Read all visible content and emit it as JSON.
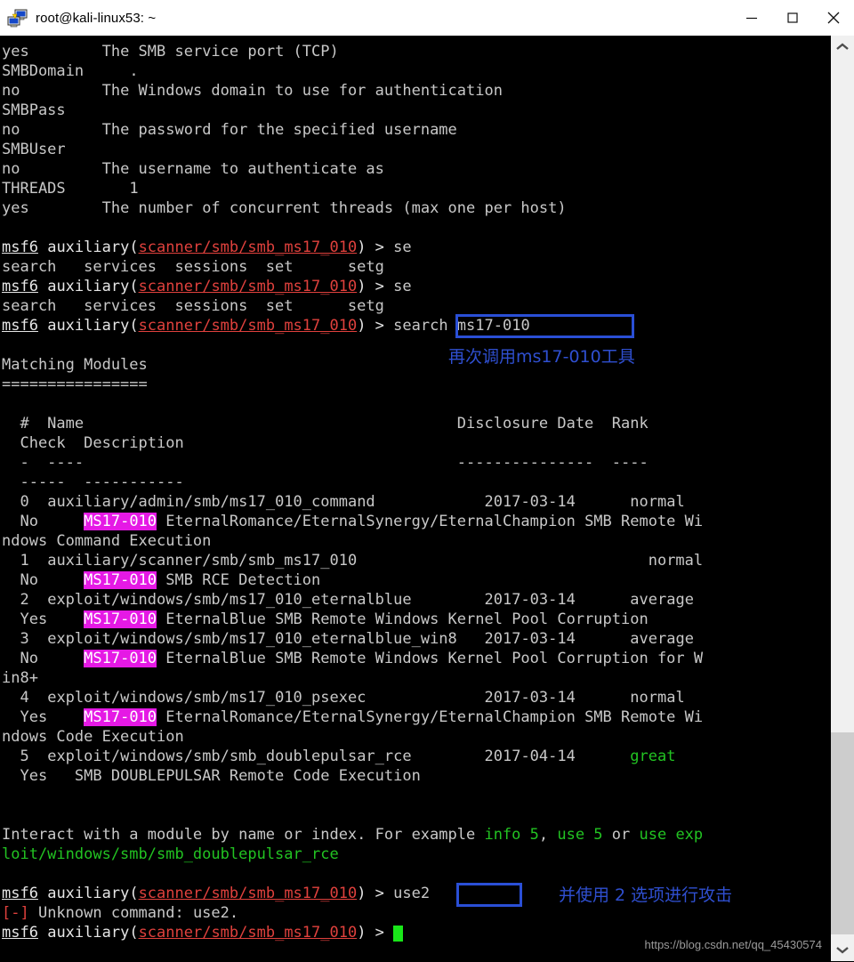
{
  "window": {
    "title": "root@kali-linux53: ~",
    "icon": "computer-network-icon",
    "minimize_label": "—",
    "maximize_label": "□",
    "close_label": "✕"
  },
  "terminal": {
    "prompt_user": "msf6",
    "prompt_cmd": "auxiliary(",
    "prompt_module": "scanner/smb/smb_ms17_010",
    "prompt_tail": ") > ",
    "options_rows": [
      {
        "value": "yes",
        "desc": "The SMB service port (TCP)"
      },
      {
        "value": "SMBDomain",
        "desc": "."
      },
      {
        "value": "no",
        "desc": "The Windows domain to use for authentication"
      },
      {
        "value": "SMBPass",
        "desc": ""
      },
      {
        "value": "no",
        "desc": "The password for the specified username"
      },
      {
        "value": "SMBUser",
        "desc": ""
      },
      {
        "value": "no",
        "desc": "The username to authenticate as"
      },
      {
        "value": "THREADS",
        "desc": "1"
      },
      {
        "value": "yes",
        "desc": "The number of concurrent threads (max one per host)"
      }
    ],
    "completion_line": "search   services  sessions  set      setg",
    "partial_command": "se",
    "search_command": "search ms17-010",
    "matching_header": "Matching Modules",
    "matching_underline": "================",
    "col_head_1": "  #  Name",
    "col_head_1_right": "Disclosure Date  Rank",
    "col_head_2": "  Check  Description",
    "col_rule_1": "  -  ----",
    "col_rule_1_right": "---------------  ----",
    "col_rule_2": "  -----  -----------",
    "modules": [
      {
        "index": "  0",
        "name": "auxiliary/admin/smb/ms17_010_command",
        "date": "2017-03-14",
        "rank": "normal",
        "rank_color": "grey",
        "check": "  No",
        "hl": "MS17-010",
        "desc": " EternalRomance/EternalSynergy/EternalChampion SMB Remote Wi",
        "desc_wrap": "ndows Command Execution"
      },
      {
        "index": "  1",
        "name": "auxiliary/scanner/smb/smb_ms17_010",
        "date": "",
        "rank": "normal",
        "rank_color": "grey",
        "check": "  No",
        "hl": "MS17-010",
        "desc": " SMB RCE Detection",
        "desc_wrap": ""
      },
      {
        "index": "  2",
        "name": "exploit/windows/smb/ms17_010_eternalblue",
        "date": "2017-03-14",
        "rank": "average",
        "rank_color": "grey",
        "check": "  Yes",
        "hl": "MS17-010",
        "desc": " EternalBlue SMB Remote Windows Kernel Pool Corruption",
        "desc_wrap": ""
      },
      {
        "index": "  3",
        "name": "exploit/windows/smb/ms17_010_eternalblue_win8",
        "date": "2017-03-14",
        "rank": "average",
        "rank_color": "grey",
        "check": "  No",
        "hl": "MS17-010",
        "desc": " EternalBlue SMB Remote Windows Kernel Pool Corruption for W",
        "desc_wrap": "in8+"
      },
      {
        "index": "  4",
        "name": "exploit/windows/smb/ms17_010_psexec",
        "date": "2017-03-14",
        "rank": "normal",
        "rank_color": "grey",
        "check": "  Yes",
        "hl": "MS17-010",
        "desc": " EternalRomance/EternalSynergy/EternalChampion SMB Remote Wi",
        "desc_wrap": "ndows Code Execution"
      },
      {
        "index": "  5",
        "name": "exploit/windows/smb/smb_doublepulsar_rce",
        "date": "2017-04-14",
        "rank": "great",
        "rank_color": "green",
        "check": "  Yes",
        "hl": "",
        "desc": "   SMB DOUBLEPULSAR Remote Code Execution",
        "desc_wrap": ""
      }
    ],
    "hint_prefix": "Interact with a module by name or index. For example ",
    "hint_g1": "info 5",
    "hint_mid1": ", ",
    "hint_g2": "use 5",
    "hint_mid2": " or ",
    "hint_g3": "use exp",
    "hint_g3_wrap": "loit/windows/smb/smb_doublepulsar_rce",
    "use2_command": "use2",
    "error_prefix": "[-]",
    "error_text": " Unknown command: use2."
  },
  "annotations": {
    "search_note": "再次调用ms17-010工具",
    "use2_note": "并使用 2 选项进行攻击",
    "accent_color": "#2a4fd6"
  },
  "watermark": {
    "text": "https://blog.csdn.net/qq_45430574"
  },
  "scrollbar": {
    "up_arrow": "∧",
    "down_arrow": "∨"
  }
}
